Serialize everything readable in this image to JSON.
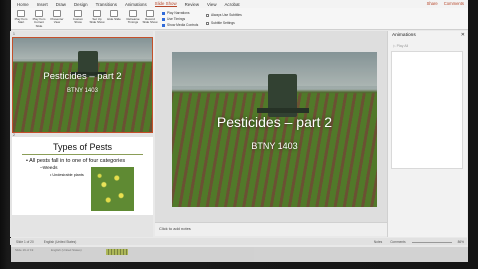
{
  "ribbon_tabs": [
    "Home",
    "Insert",
    "Draw",
    "Design",
    "Transitions",
    "Animations",
    "Slide Show",
    "Review",
    "View",
    "Acrobat"
  ],
  "active_tab": "Slide Show",
  "share_label": "Share",
  "comments_label": "Comments",
  "ribbon_buttons": [
    {
      "label": "Play from Start",
      "icon": "play-start-icon"
    },
    {
      "label": "Play from Current Slide",
      "icon": "play-current-icon"
    },
    {
      "label": "Presenter View",
      "icon": "presenter-view-icon"
    },
    {
      "label": "Custom Show",
      "icon": "custom-show-icon"
    },
    {
      "label": "Set Up Slide Show",
      "icon": "setup-icon"
    },
    {
      "label": "Hide Slide",
      "icon": "hide-slide-icon"
    },
    {
      "label": "Rehearse Timings",
      "icon": "rehearse-icon"
    },
    {
      "label": "Record Slide Show",
      "icon": "record-icon"
    }
  ],
  "ribbon_checks": [
    {
      "label": "Play Narrations",
      "checked": true
    },
    {
      "label": "Use Timings",
      "checked": true
    },
    {
      "label": "Show Media Controls",
      "checked": true
    },
    {
      "label": "Always Use Subtitles",
      "checked": false
    },
    {
      "label": "Subtitle Settings",
      "checked": false
    }
  ],
  "thumbnails": {
    "slide1": {
      "number": "1",
      "title": "Pesticides – part 2",
      "subtitle": "BTNY 1403"
    },
    "slide2": {
      "number": "2",
      "title": "Types of Pests",
      "bullet1": "All pests fall in to one of four categories",
      "bullet2": "–Weeds",
      "bullet3": "• Undesirable plants"
    }
  },
  "main_slide": {
    "title": "Pesticides – part 2",
    "subtitle": "BTNY 1403"
  },
  "notes_placeholder": "Click to add notes",
  "animations_pane": {
    "title": "Animations",
    "play_label": "▷ Play All"
  },
  "status": {
    "slide_of": "Slide 1 of 20",
    "language": "English (United States)",
    "notes": "Notes",
    "comments": "Comments",
    "zoom": "86%"
  },
  "ghost_status": {
    "slide_of": "Slide 19 of 19",
    "language": "English (United States)"
  }
}
